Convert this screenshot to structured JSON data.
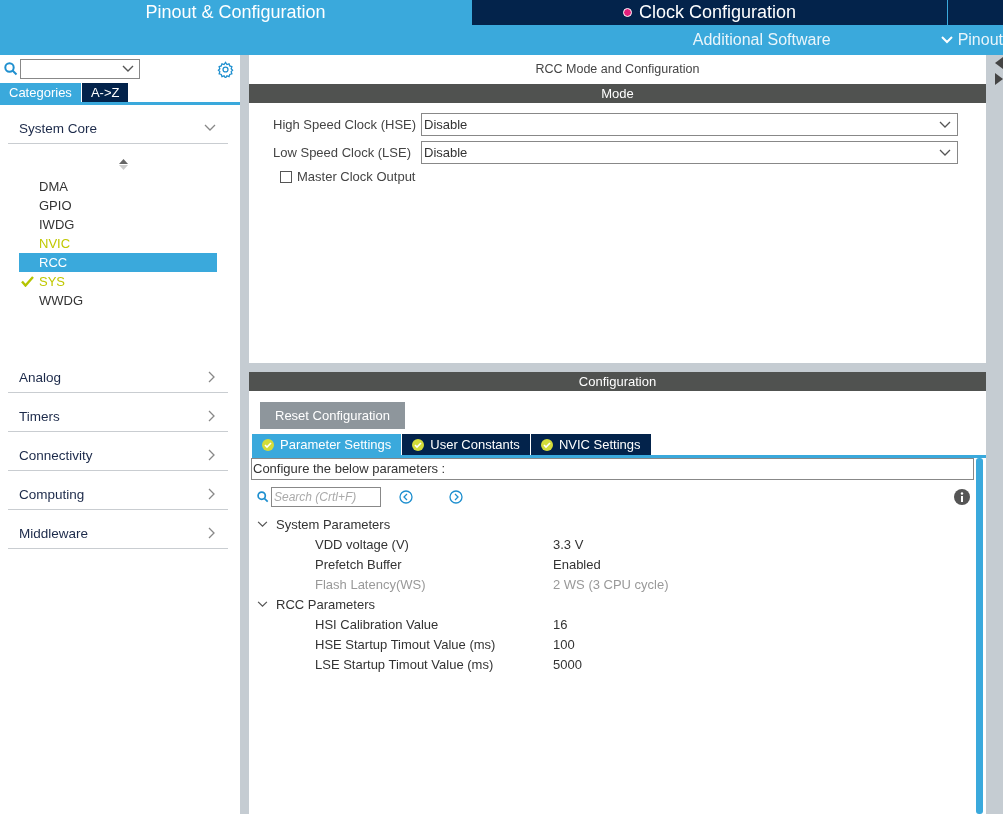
{
  "top_tabs": [
    {
      "label": "Pinout & Configuration",
      "selected": true,
      "marker": false
    },
    {
      "label": "Clock Configuration",
      "selected": false,
      "marker": true
    },
    {
      "selected": false,
      "marker": false
    }
  ],
  "sub_menu": [
    "Additional Software",
    "Pinout"
  ],
  "sidebar": {
    "view_tabs": [
      {
        "label": "Categories",
        "selected": true
      },
      {
        "label": "A->Z",
        "selected": false
      }
    ],
    "categories": [
      {
        "label": "System Core",
        "expanded": true,
        "items": [
          {
            "label": "DMA",
            "selected": false,
            "configured": false,
            "checked": false
          },
          {
            "label": "GPIO",
            "selected": false,
            "configured": false,
            "checked": false
          },
          {
            "label": "IWDG",
            "selected": false,
            "configured": false,
            "checked": false
          },
          {
            "label": "NVIC",
            "selected": false,
            "configured": true,
            "checked": false
          },
          {
            "label": "RCC",
            "selected": true,
            "configured": false,
            "checked": false
          },
          {
            "label": "SYS",
            "selected": false,
            "configured": true,
            "checked": true
          },
          {
            "label": "WWDG",
            "selected": false,
            "configured": false,
            "checked": false
          }
        ]
      },
      {
        "label": "Analog",
        "expanded": false
      },
      {
        "label": "Timers",
        "expanded": false
      },
      {
        "label": "Connectivity",
        "expanded": false
      },
      {
        "label": "Computing",
        "expanded": false
      },
      {
        "label": "Middleware",
        "expanded": false
      }
    ]
  },
  "mode_panel": {
    "title": "RCC Mode and Configuration",
    "header": "Mode",
    "fields": [
      {
        "label": "High Speed Clock (HSE)",
        "value": "Disable"
      },
      {
        "label": "Low Speed Clock (LSE)",
        "value": "Disable"
      }
    ],
    "checkbox": {
      "label": "Master Clock Output",
      "checked": false
    }
  },
  "config_panel": {
    "header": "Configuration",
    "reset_button": "Reset Configuration",
    "tabs": [
      {
        "label": "Parameter Settings",
        "selected": true
      },
      {
        "label": "User Constants",
        "selected": false
      },
      {
        "label": "NVIC Settings",
        "selected": false
      }
    ],
    "hint": "Configure the below parameters :",
    "search": {
      "placeholder": "Search (Crtl+F)"
    },
    "groups": [
      {
        "label": "System Parameters",
        "expanded": true,
        "params": [
          {
            "name": "VDD voltage (V)",
            "value": "3.3 V",
            "disabled": false
          },
          {
            "name": "Prefetch Buffer",
            "value": "Enabled",
            "disabled": false
          },
          {
            "name": "Flash Latency(WS)",
            "value": "2 WS (3 CPU cycle)",
            "disabled": true
          }
        ]
      },
      {
        "label": "RCC Parameters",
        "expanded": true,
        "params": [
          {
            "name": "HSI Calibration Value",
            "value": "16",
            "disabled": false
          },
          {
            "name": "HSE Startup Timout Value (ms)",
            "value": "100",
            "disabled": false
          },
          {
            "name": "LSE Startup Timout Value (ms)",
            "value": "5000",
            "disabled": false
          }
        ]
      }
    ]
  }
}
